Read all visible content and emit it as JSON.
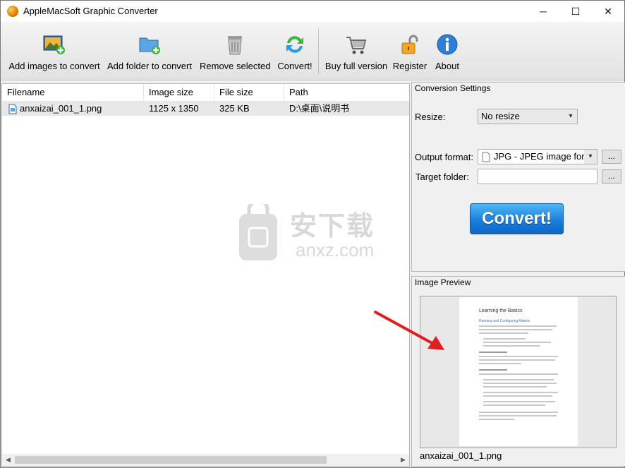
{
  "window": {
    "title": "AppleMacSoft Graphic Converter",
    "controls": {
      "minimize": "─",
      "maximize": "☐",
      "close": "✕"
    }
  },
  "toolbar": {
    "buttons": [
      {
        "label": "Add images to convert",
        "icon": "add-images-icon"
      },
      {
        "label": "Add folder to convert",
        "icon": "add-folder-icon"
      },
      {
        "label": "Remove selected",
        "icon": "trash-icon"
      },
      {
        "label": "Convert!",
        "icon": "convert-arrows-icon"
      },
      {
        "label": "Buy full version",
        "icon": "shopping-cart-icon"
      },
      {
        "label": "Register",
        "icon": "lock-icon"
      },
      {
        "label": "About",
        "icon": "info-icon"
      }
    ]
  },
  "filelist": {
    "columns": [
      "Filename",
      "Image size",
      "File size",
      "Path"
    ],
    "rows": [
      {
        "filename": "anxaizai_001_1.png",
        "image_size": "1125 x 1350",
        "file_size": "325 KB",
        "path": "D:\\桌面\\说明书"
      }
    ]
  },
  "watermark": {
    "text": "安下载",
    "sub": "anxz.com"
  },
  "settings": {
    "title": "Conversion Settings",
    "resize_label": "Resize:",
    "resize_value": "No resize",
    "output_label": "Output format:",
    "output_value": "JPG - JPEG image form",
    "target_label": "Target folder:",
    "target_value": "",
    "browse": "...",
    "convert": "Convert!"
  },
  "preview": {
    "title": "Image Preview",
    "filename": "anxaizai_001_1.png",
    "doc_title": "Learning the Basics",
    "doc_sub": "Running and Configuring Adams"
  },
  "colors": {
    "convert_button": "#1a7fdb",
    "arrow": "#e02020"
  }
}
